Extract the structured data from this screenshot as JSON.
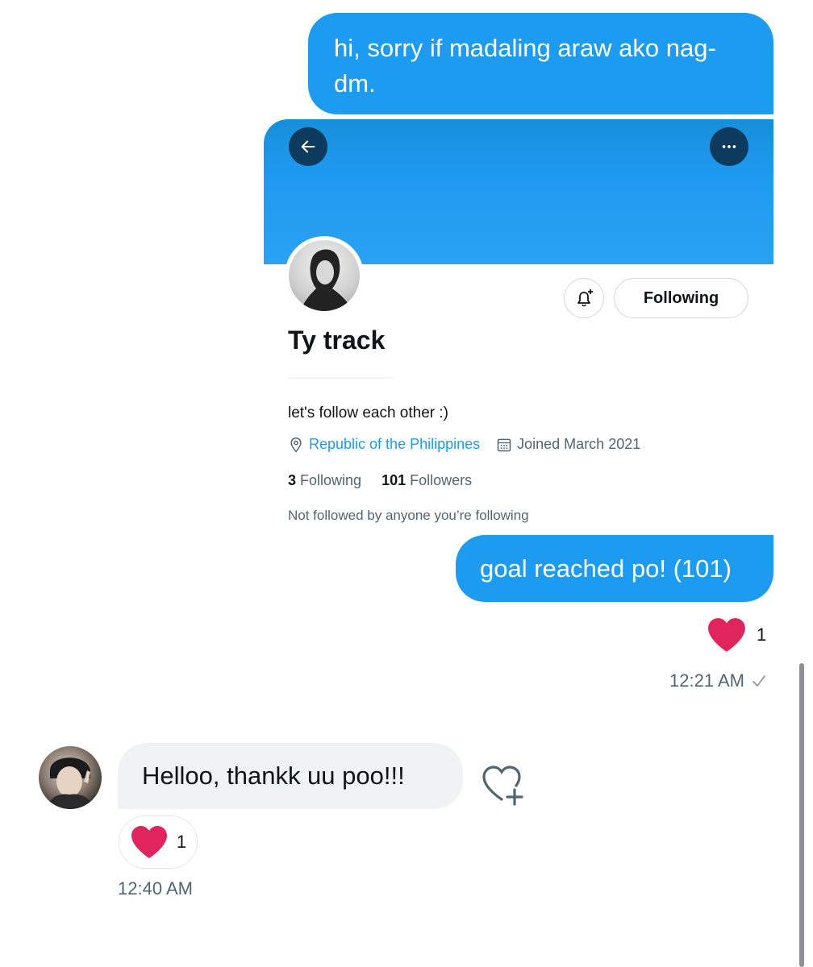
{
  "messages": {
    "outgoing_1": "hi, sorry if madaling araw ako nag-dm.",
    "outgoing_2": "goal reached po! (101)",
    "incoming_1": "Helloo, thankk uu poo!!!"
  },
  "profile_card": {
    "name": "Ty track",
    "following_button": "Following",
    "bio": "let's follow each other :)",
    "location": "Republic of the Philippines",
    "joined": "Joined March 2021",
    "following_count": "3",
    "following_label": "Following",
    "followers_count": "101",
    "followers_label": "Followers",
    "not_followed": "Not followed by anyone you’re following",
    "icons": [
      "back-arrow-icon",
      "more-icon",
      "bell-plus-icon",
      "location-pin-icon",
      "calendar-icon"
    ]
  },
  "reactions": {
    "outgoing_2_heart_count": "1",
    "incoming_1_heart_count": "1"
  },
  "timestamps": {
    "outgoing": "12:21 AM",
    "incoming": "12:40 AM"
  },
  "colors": {
    "accent": "#1d9bf0",
    "heart": "#e0245e",
    "incoming_bubble": "#eff3f4"
  }
}
